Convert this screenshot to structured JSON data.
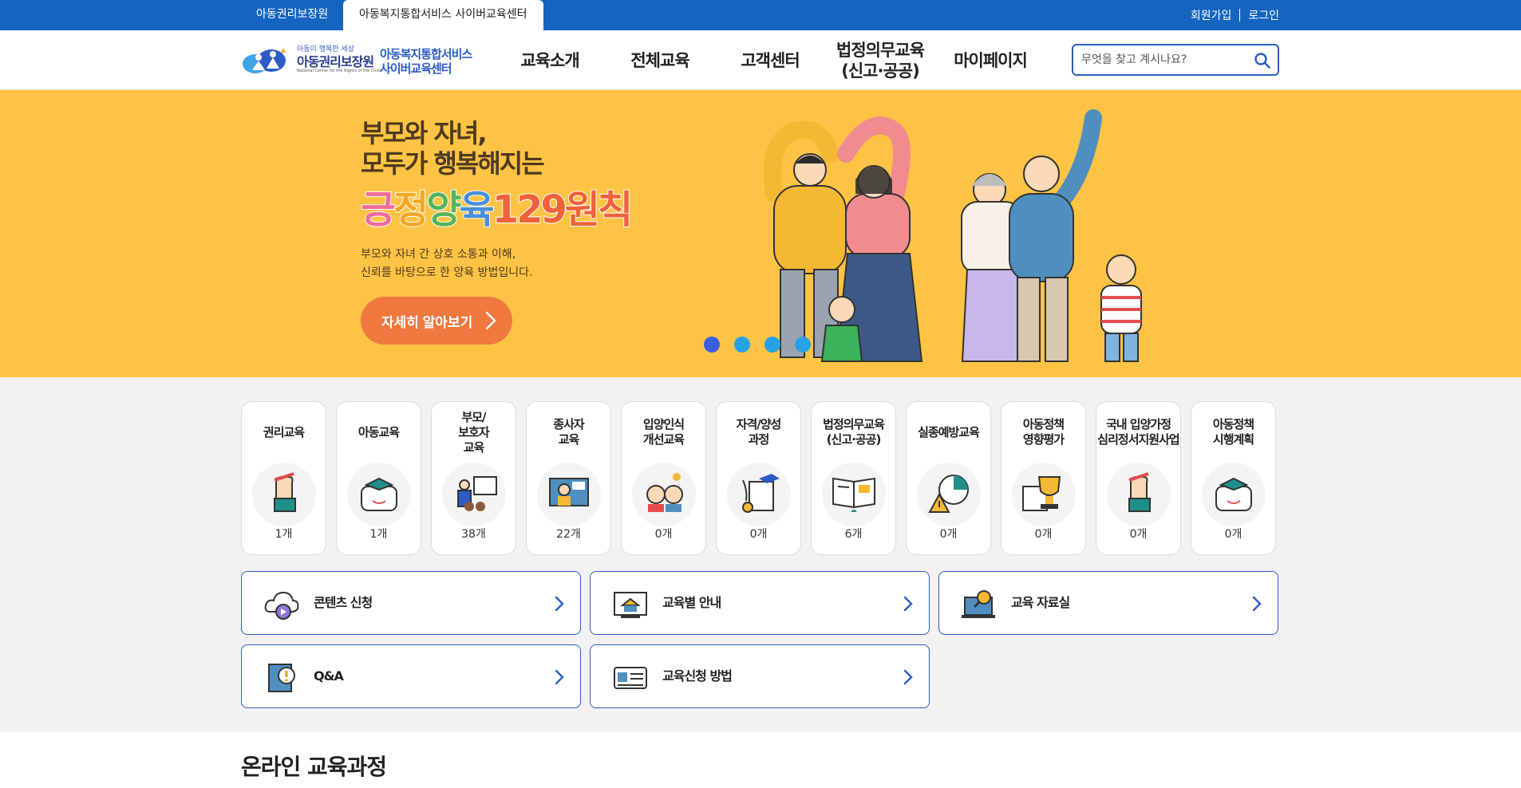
{
  "topbar": {
    "tabs": [
      {
        "label": "아동권리보장원"
      },
      {
        "label": "아동복지통합서비스 사이버교육센터"
      }
    ],
    "signup": "회원가입",
    "login": "로그인"
  },
  "header": {
    "logo_tagline": "아동이 행복한 세상",
    "logo_org": "아동권리보장원",
    "logo_org_en": "National Center for the Rights of the Child",
    "logo_service": "아동복지통합서비스\n사이버교육센터",
    "menu": [
      {
        "label": "교육소개"
      },
      {
        "label": "전체교육"
      },
      {
        "label": "고객센터"
      },
      {
        "label": "법정의무교육\n(신고·공공)"
      },
      {
        "label": "마이페이지"
      }
    ],
    "search": {
      "placeholder": "무엇을 찾고 계시나요?",
      "value": ""
    }
  },
  "banner": {
    "headline": "부모와 자녀,\n모두가 행복해지는",
    "highlight_parts": [
      "긍",
      "정",
      "양",
      "육",
      "129원칙"
    ],
    "description": "부모와 자녀 간 상호 소통과 이해,\n신뢰를 바탕으로 한 양육 방법입니다.",
    "cta": "자세히 알아보기",
    "slides": 4,
    "active_slide": 1,
    "colors": {
      "background": "#fec344",
      "cta": "#f07940",
      "dot": "#27a2e6",
      "dot_active": "#3b5de0"
    }
  },
  "categories": [
    {
      "title": "권리교육",
      "icon": "raised-hand-icon",
      "count": "1개"
    },
    {
      "title": "아동교육",
      "icon": "graduate-speech-icon",
      "count": "1개"
    },
    {
      "title": "부모/\n보호자\n교육",
      "icon": "family-presentation-icon",
      "count": "38개"
    },
    {
      "title": "종사자\n교육",
      "icon": "online-teacher-icon",
      "count": "22개"
    },
    {
      "title": "입양인식\n개선교육",
      "icon": "children-icon",
      "count": "0개"
    },
    {
      "title": "자격/양성\n과정",
      "icon": "certificate-icon",
      "count": "0개"
    },
    {
      "title": "법정의무교육\n(신고·공공)",
      "icon": "open-book-icon",
      "count": "6개"
    },
    {
      "title": "실종예방교육",
      "icon": "warning-chart-icon",
      "count": "0개"
    },
    {
      "title": "아동정책\n영향평가",
      "icon": "trophy-icon",
      "count": "0개"
    },
    {
      "title": "국내 입양가정\n심리정서지원사업",
      "icon": "raised-hand-icon",
      "count": "0개"
    },
    {
      "title": "아동정책\n시행계획",
      "icon": "graduate-speech-icon",
      "count": "0개"
    }
  ],
  "quick_links": [
    {
      "label": "콘텐츠 신청",
      "icon": "cloud-play-icon"
    },
    {
      "label": "교육별 안내",
      "icon": "monitor-school-icon"
    },
    {
      "label": "교육 자료실",
      "icon": "laptop-search-icon"
    },
    {
      "label": "Q&A",
      "icon": "book-alert-icon"
    },
    {
      "label": "교육신청 방법",
      "icon": "id-card-icon"
    }
  ],
  "section": {
    "title": "온라인 교육과정"
  }
}
